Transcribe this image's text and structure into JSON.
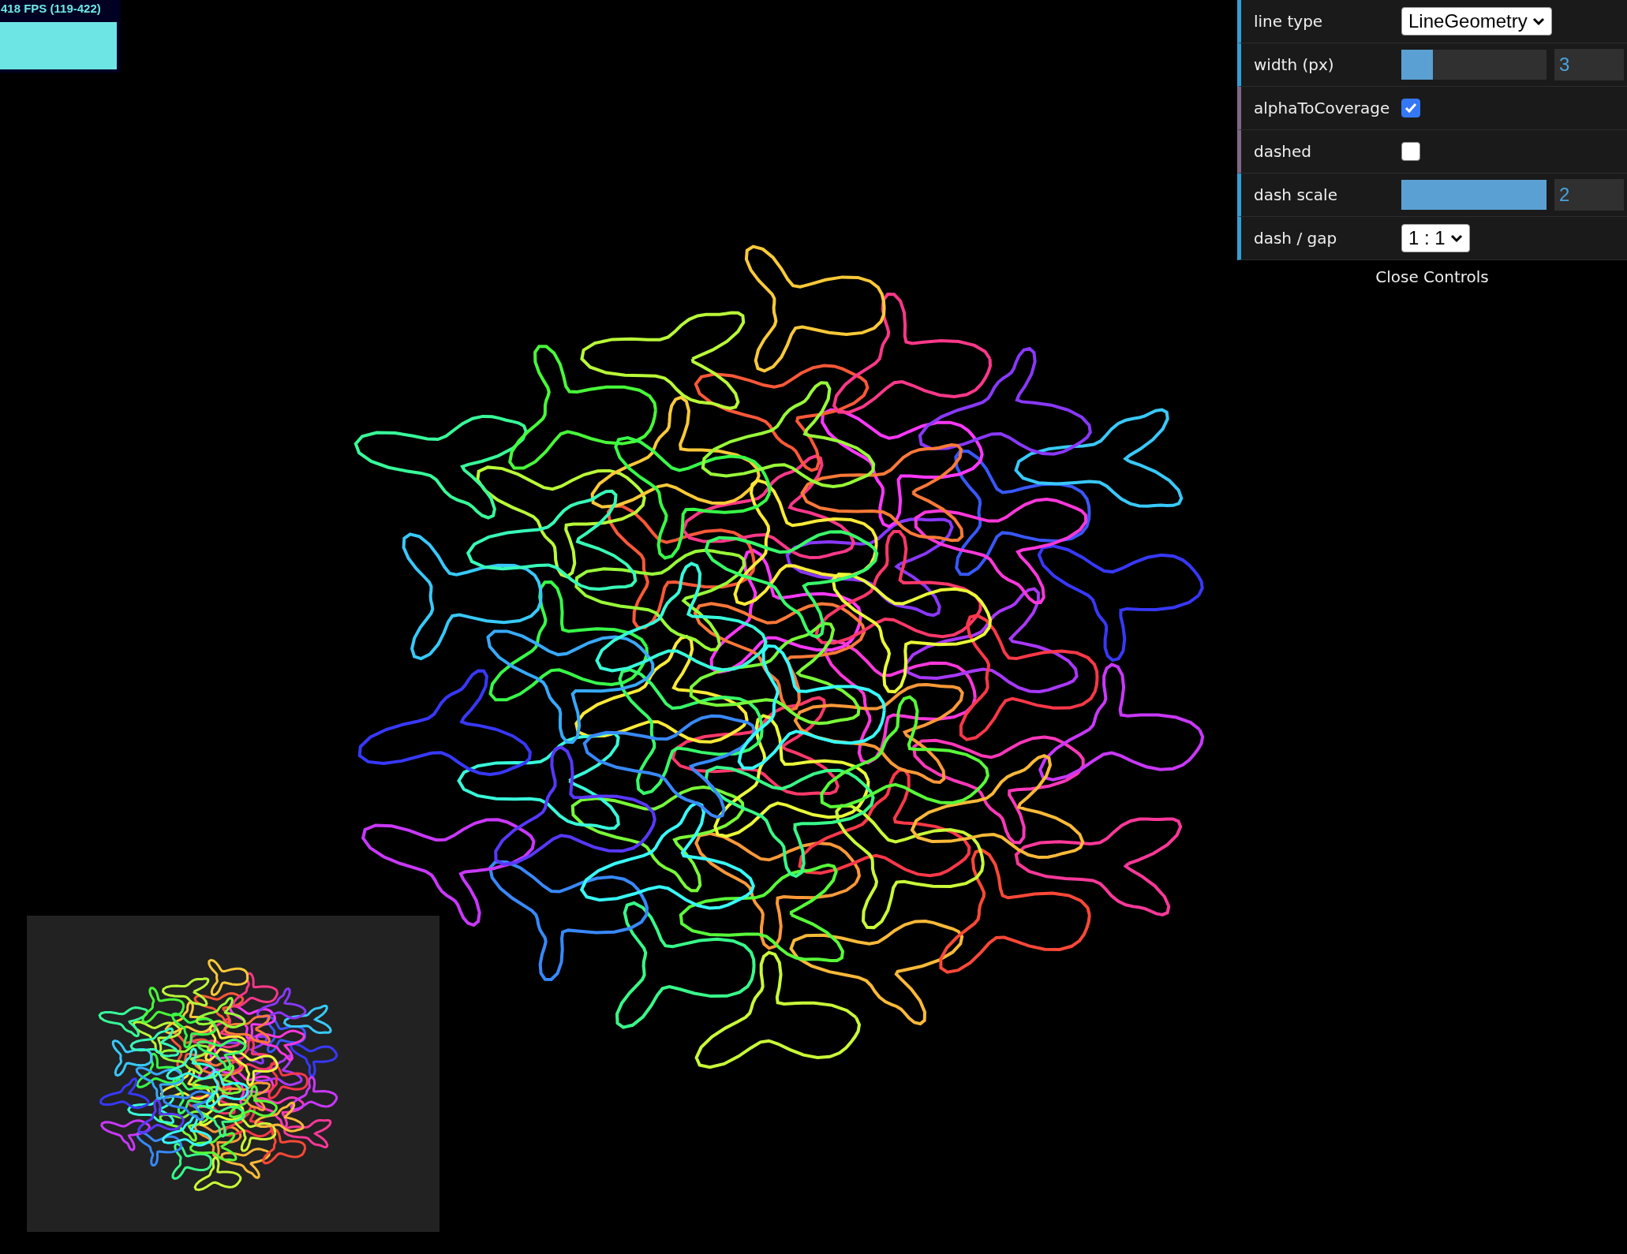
{
  "fps": {
    "text": "418 FPS (119-422)"
  },
  "controls": [
    {
      "kind": "select",
      "label": "line type",
      "value": "LineGeometry"
    },
    {
      "kind": "slider",
      "label": "width (px)",
      "level": 0.22,
      "value": "3"
    },
    {
      "kind": "checkbox",
      "label": "alphaToCoverage",
      "checked": true
    },
    {
      "kind": "checkbox",
      "label": "dashed",
      "checked": false
    },
    {
      "kind": "slider",
      "label": "dash scale",
      "level": 1,
      "value": "2"
    },
    {
      "kind": "select",
      "label": "dash / gap",
      "value": "1 : 1"
    }
  ],
  "close_button": "Close Controls"
}
